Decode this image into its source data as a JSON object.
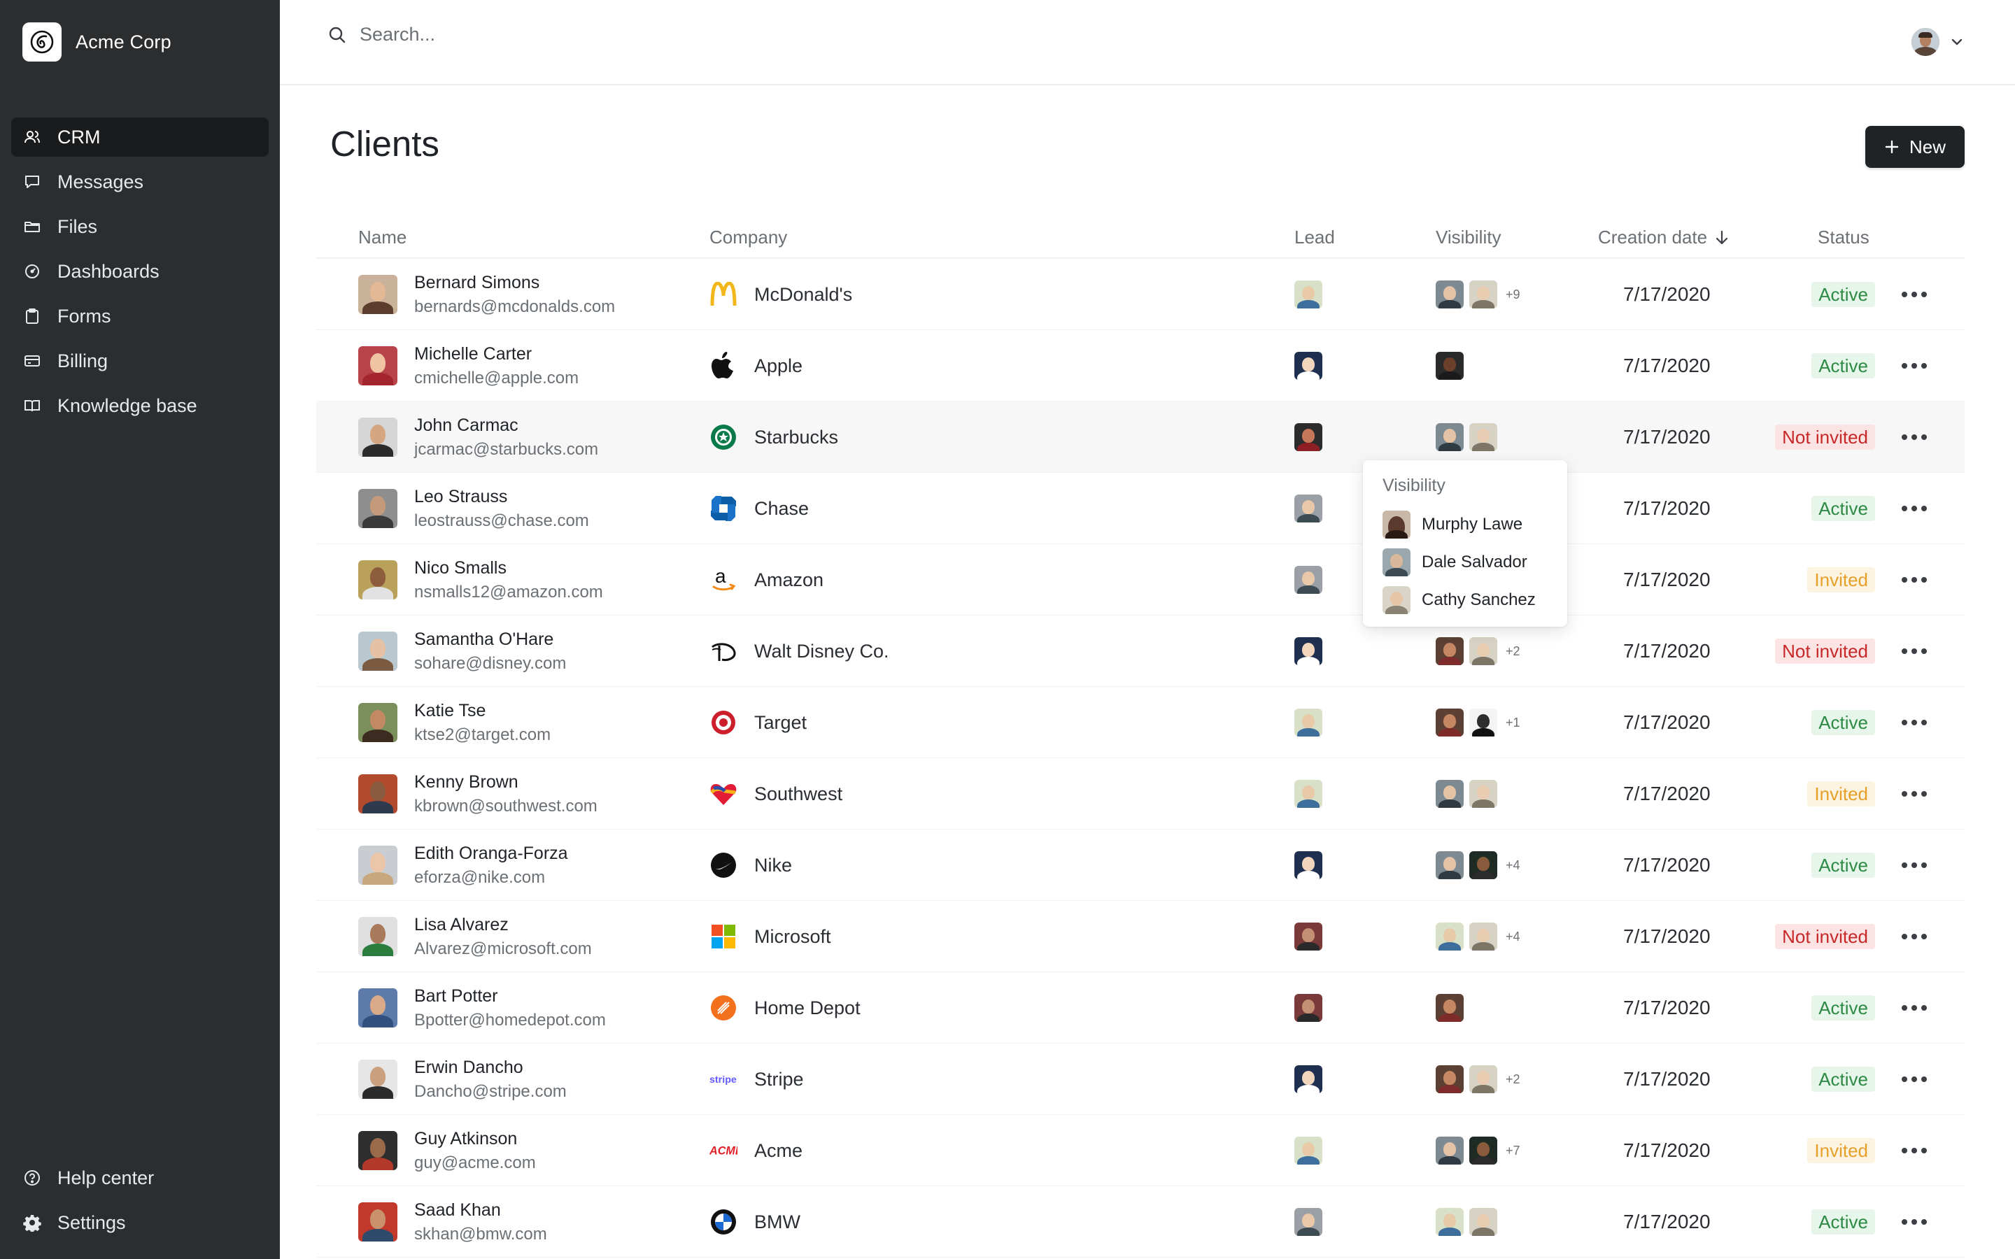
{
  "app": {
    "org_name": "Acme Corp",
    "accent": "#202326",
    "sidebar_bg": "#2b2d2f"
  },
  "sidebar": {
    "items": [
      {
        "label": "CRM",
        "icon": "users-icon",
        "active": true
      },
      {
        "label": "Messages",
        "icon": "chat-bubble-icon",
        "active": false
      },
      {
        "label": "Files",
        "icon": "folder-icon",
        "active": false
      },
      {
        "label": "Dashboards",
        "icon": "gauge-icon",
        "active": false
      },
      {
        "label": "Forms",
        "icon": "clipboard-icon",
        "active": false
      },
      {
        "label": "Billing",
        "icon": "credit-card-icon",
        "active": false
      },
      {
        "label": "Knowledge base",
        "icon": "book-icon",
        "active": false
      }
    ],
    "bottom": [
      {
        "label": "Help center",
        "icon": "help-circle-icon"
      },
      {
        "label": "Settings",
        "icon": "gear-icon"
      }
    ]
  },
  "topbar": {
    "search_placeholder": "Search..."
  },
  "page": {
    "title": "Clients",
    "new_button": "New"
  },
  "table": {
    "columns": {
      "name": "Name",
      "company": "Company",
      "lead": "Lead",
      "visibility": "Visibility",
      "creation_date": "Creation date",
      "status": "Status"
    },
    "sort": {
      "column": "creation_date",
      "direction": "desc"
    },
    "rows": [
      {
        "name": "Bernard Simons",
        "email": "bernards@mcdonalds.com",
        "company": "McDonald's",
        "logo": "mcdonalds-logo",
        "date": "7/17/2020",
        "status": "Active",
        "status_kind": "active",
        "vis_extra": "+9"
      },
      {
        "name": "Michelle Carter",
        "email": "cmichelle@apple.com",
        "company": "Apple",
        "logo": "apple-logo",
        "date": "7/17/2020",
        "status": "Active",
        "status_kind": "active",
        "vis_extra": ""
      },
      {
        "name": "John Carmac",
        "email": "jcarmac@starbucks.com",
        "company": "Starbucks",
        "logo": "starbucks-logo",
        "date": "7/17/2020",
        "status": "Not invited",
        "status_kind": "not-invited",
        "vis_extra": ""
      },
      {
        "name": "Leo Strauss",
        "email": "leostrauss@chase.com",
        "company": "Chase",
        "logo": "chase-logo",
        "date": "7/17/2020",
        "status": "Active",
        "status_kind": "active",
        "vis_extra": ""
      },
      {
        "name": "Nico Smalls",
        "email": "nsmalls12@amazon.com",
        "company": "Amazon",
        "logo": "amazon-logo",
        "date": "7/17/2020",
        "status": "Invited",
        "status_kind": "invited",
        "vis_extra": ""
      },
      {
        "name": "Samantha O'Hare",
        "email": "sohare@disney.com",
        "company": "Walt Disney Co.",
        "logo": "disney-logo",
        "date": "7/17/2020",
        "status": "Not invited",
        "status_kind": "not-invited",
        "vis_extra": "+2"
      },
      {
        "name": "Katie Tse",
        "email": "ktse2@target.com",
        "company": "Target",
        "logo": "target-logo",
        "date": "7/17/2020",
        "status": "Active",
        "status_kind": "active",
        "vis_extra": "+1"
      },
      {
        "name": "Kenny Brown",
        "email": "kbrown@southwest.com",
        "company": "Southwest",
        "logo": "southwest-logo",
        "date": "7/17/2020",
        "status": "Invited",
        "status_kind": "invited",
        "vis_extra": ""
      },
      {
        "name": "Edith Oranga-Forza",
        "email": "eforza@nike.com",
        "company": "Nike",
        "logo": "nike-logo",
        "date": "7/17/2020",
        "status": "Active",
        "status_kind": "active",
        "vis_extra": "+4"
      },
      {
        "name": "Lisa Alvarez",
        "email": "Alvarez@microsoft.com",
        "company": "Microsoft",
        "logo": "microsoft-logo",
        "date": "7/17/2020",
        "status": "Not invited",
        "status_kind": "not-invited",
        "vis_extra": "+4"
      },
      {
        "name": "Bart Potter",
        "email": "Bpotter@homedepot.com",
        "company": "Home Depot",
        "logo": "homedepot-logo",
        "date": "7/17/2020",
        "status": "Active",
        "status_kind": "active",
        "vis_extra": ""
      },
      {
        "name": "Erwin Dancho",
        "email": "Dancho@stripe.com",
        "company": "Stripe",
        "logo": "stripe-logo",
        "date": "7/17/2020",
        "status": "Active",
        "status_kind": "active",
        "vis_extra": "+2"
      },
      {
        "name": "Guy Atkinson",
        "email": "guy@acme.com",
        "company": "Acme",
        "logo": "acme-logo",
        "date": "7/17/2020",
        "status": "Invited",
        "status_kind": "invited",
        "vis_extra": "+7"
      },
      {
        "name": "Saad Khan",
        "email": "skhan@bmw.com",
        "company": "BMW",
        "logo": "bmw-logo",
        "date": "7/17/2020",
        "status": "Active",
        "status_kind": "active",
        "vis_extra": ""
      }
    ]
  },
  "popover": {
    "title": "Visibility",
    "people": [
      "Murphy Lawe",
      "Dale Salvador",
      "Cathy Sanchez"
    ]
  },
  "status_colors": {
    "active": "#2d8a44",
    "invited": "#e6a02a",
    "not_invited": "#c62828"
  }
}
